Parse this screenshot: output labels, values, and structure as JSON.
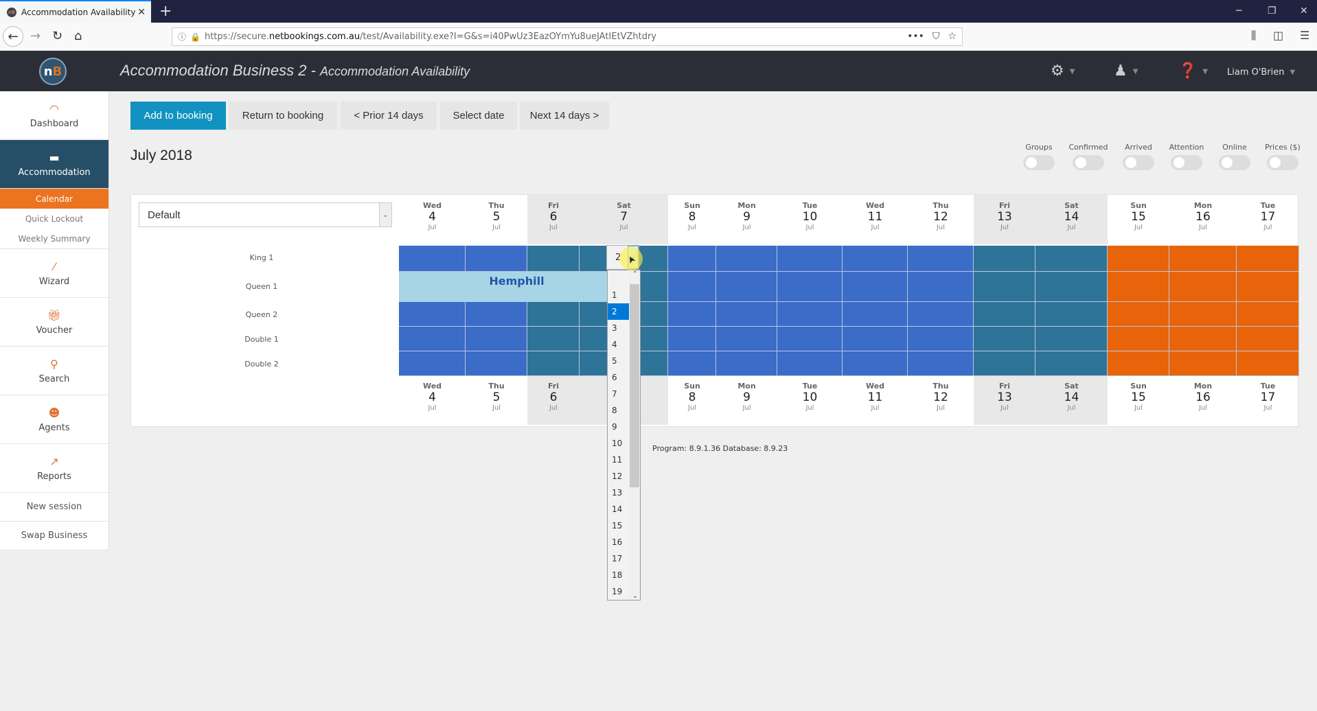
{
  "browser": {
    "tab_title": "Accommodation Availability",
    "url_prefix": "https://secure.",
    "url_domain": "netbookings.com.au",
    "url_path": "/test/Availability.exe?I=G&s=i40PwUz3EazOYmYu8ueJAtIEtVZhtdry"
  },
  "header": {
    "business": "Accommodation Business 2 - ",
    "page": "Accommodation Availability",
    "user": "Liam O'Brien"
  },
  "sidebar": {
    "items": [
      {
        "label": "Dashboard",
        "icon": "dashboard-icon"
      },
      {
        "label": "Accommodation",
        "icon": "bed-icon"
      },
      {
        "label": "Wizard",
        "icon": "wand-icon"
      },
      {
        "label": "Voucher",
        "icon": "gift-icon"
      },
      {
        "label": "Search",
        "icon": "search-icon"
      },
      {
        "label": "Agents",
        "icon": "agent-icon"
      },
      {
        "label": "Reports",
        "icon": "chart-icon"
      }
    ],
    "subitems": [
      "Calendar",
      "Quick Lockout",
      "Weekly Summary"
    ],
    "bottom": [
      "New session",
      "Swap Business"
    ]
  },
  "toolbar": {
    "add": "Add to booking",
    "return": "Return to booking",
    "prior": "< Prior 14 days",
    "select": "Select date",
    "next": "Next 14 days >"
  },
  "month": "July 2018",
  "toggles": [
    {
      "label": "Groups",
      "on": false
    },
    {
      "label": "Confirmed",
      "on": false
    },
    {
      "label": "Arrived",
      "on": false
    },
    {
      "label": "Attention",
      "on": false
    },
    {
      "label": "Online",
      "on": false
    },
    {
      "label": "Prices ($)",
      "on": false
    }
  ],
  "calendar": {
    "room_filter": "Default",
    "rooms": [
      "King 1",
      "Queen 1",
      "Queen 2",
      "Double 1",
      "Double 2"
    ],
    "days": [
      {
        "dow": "Wed",
        "day": "4",
        "mon": "Jul",
        "weekend": false
      },
      {
        "dow": "Thu",
        "day": "5",
        "mon": "Jul",
        "weekend": false
      },
      {
        "dow": "Fri",
        "day": "6",
        "mon": "Jul",
        "weekend": true
      },
      {
        "dow": "Sat",
        "day": "7",
        "mon": "Jul",
        "weekend": true
      },
      {
        "dow": "Sun",
        "day": "8",
        "mon": "Jul",
        "weekend": false
      },
      {
        "dow": "Mon",
        "day": "9",
        "mon": "Jul",
        "weekend": false
      },
      {
        "dow": "Tue",
        "day": "10",
        "mon": "Jul",
        "weekend": false
      },
      {
        "dow": "Wed",
        "day": "11",
        "mon": "Jul",
        "weekend": false
      },
      {
        "dow": "Thu",
        "day": "12",
        "mon": "Jul",
        "weekend": false
      },
      {
        "dow": "Fri",
        "day": "13",
        "mon": "Jul",
        "weekend": true
      },
      {
        "dow": "Sat",
        "day": "14",
        "mon": "Jul",
        "weekend": true
      },
      {
        "dow": "Sun",
        "day": "15",
        "mon": "Jul",
        "weekend": false
      },
      {
        "dow": "Mon",
        "day": "16",
        "mon": "Jul",
        "weekend": false
      },
      {
        "dow": "Tue",
        "day": "17",
        "mon": "Jul",
        "weekend": false
      }
    ],
    "colors": {
      "weekday": "#3a6cc8",
      "weekend": "#2e7398",
      "peak": "#e8640a",
      "booking": "#a8d5e5"
    },
    "booking": {
      "guest": "Hemphill",
      "room": "Queen 1"
    },
    "nights_select": {
      "value": "2",
      "options": [
        "1",
        "2",
        "3",
        "4",
        "5",
        "6",
        "7",
        "8",
        "9",
        "10",
        "11",
        "12",
        "13",
        "14",
        "15",
        "16",
        "17",
        "18",
        "19"
      ]
    }
  },
  "footer": {
    "version": "Program: 8.9.1.36 Database: 8.9.23"
  }
}
